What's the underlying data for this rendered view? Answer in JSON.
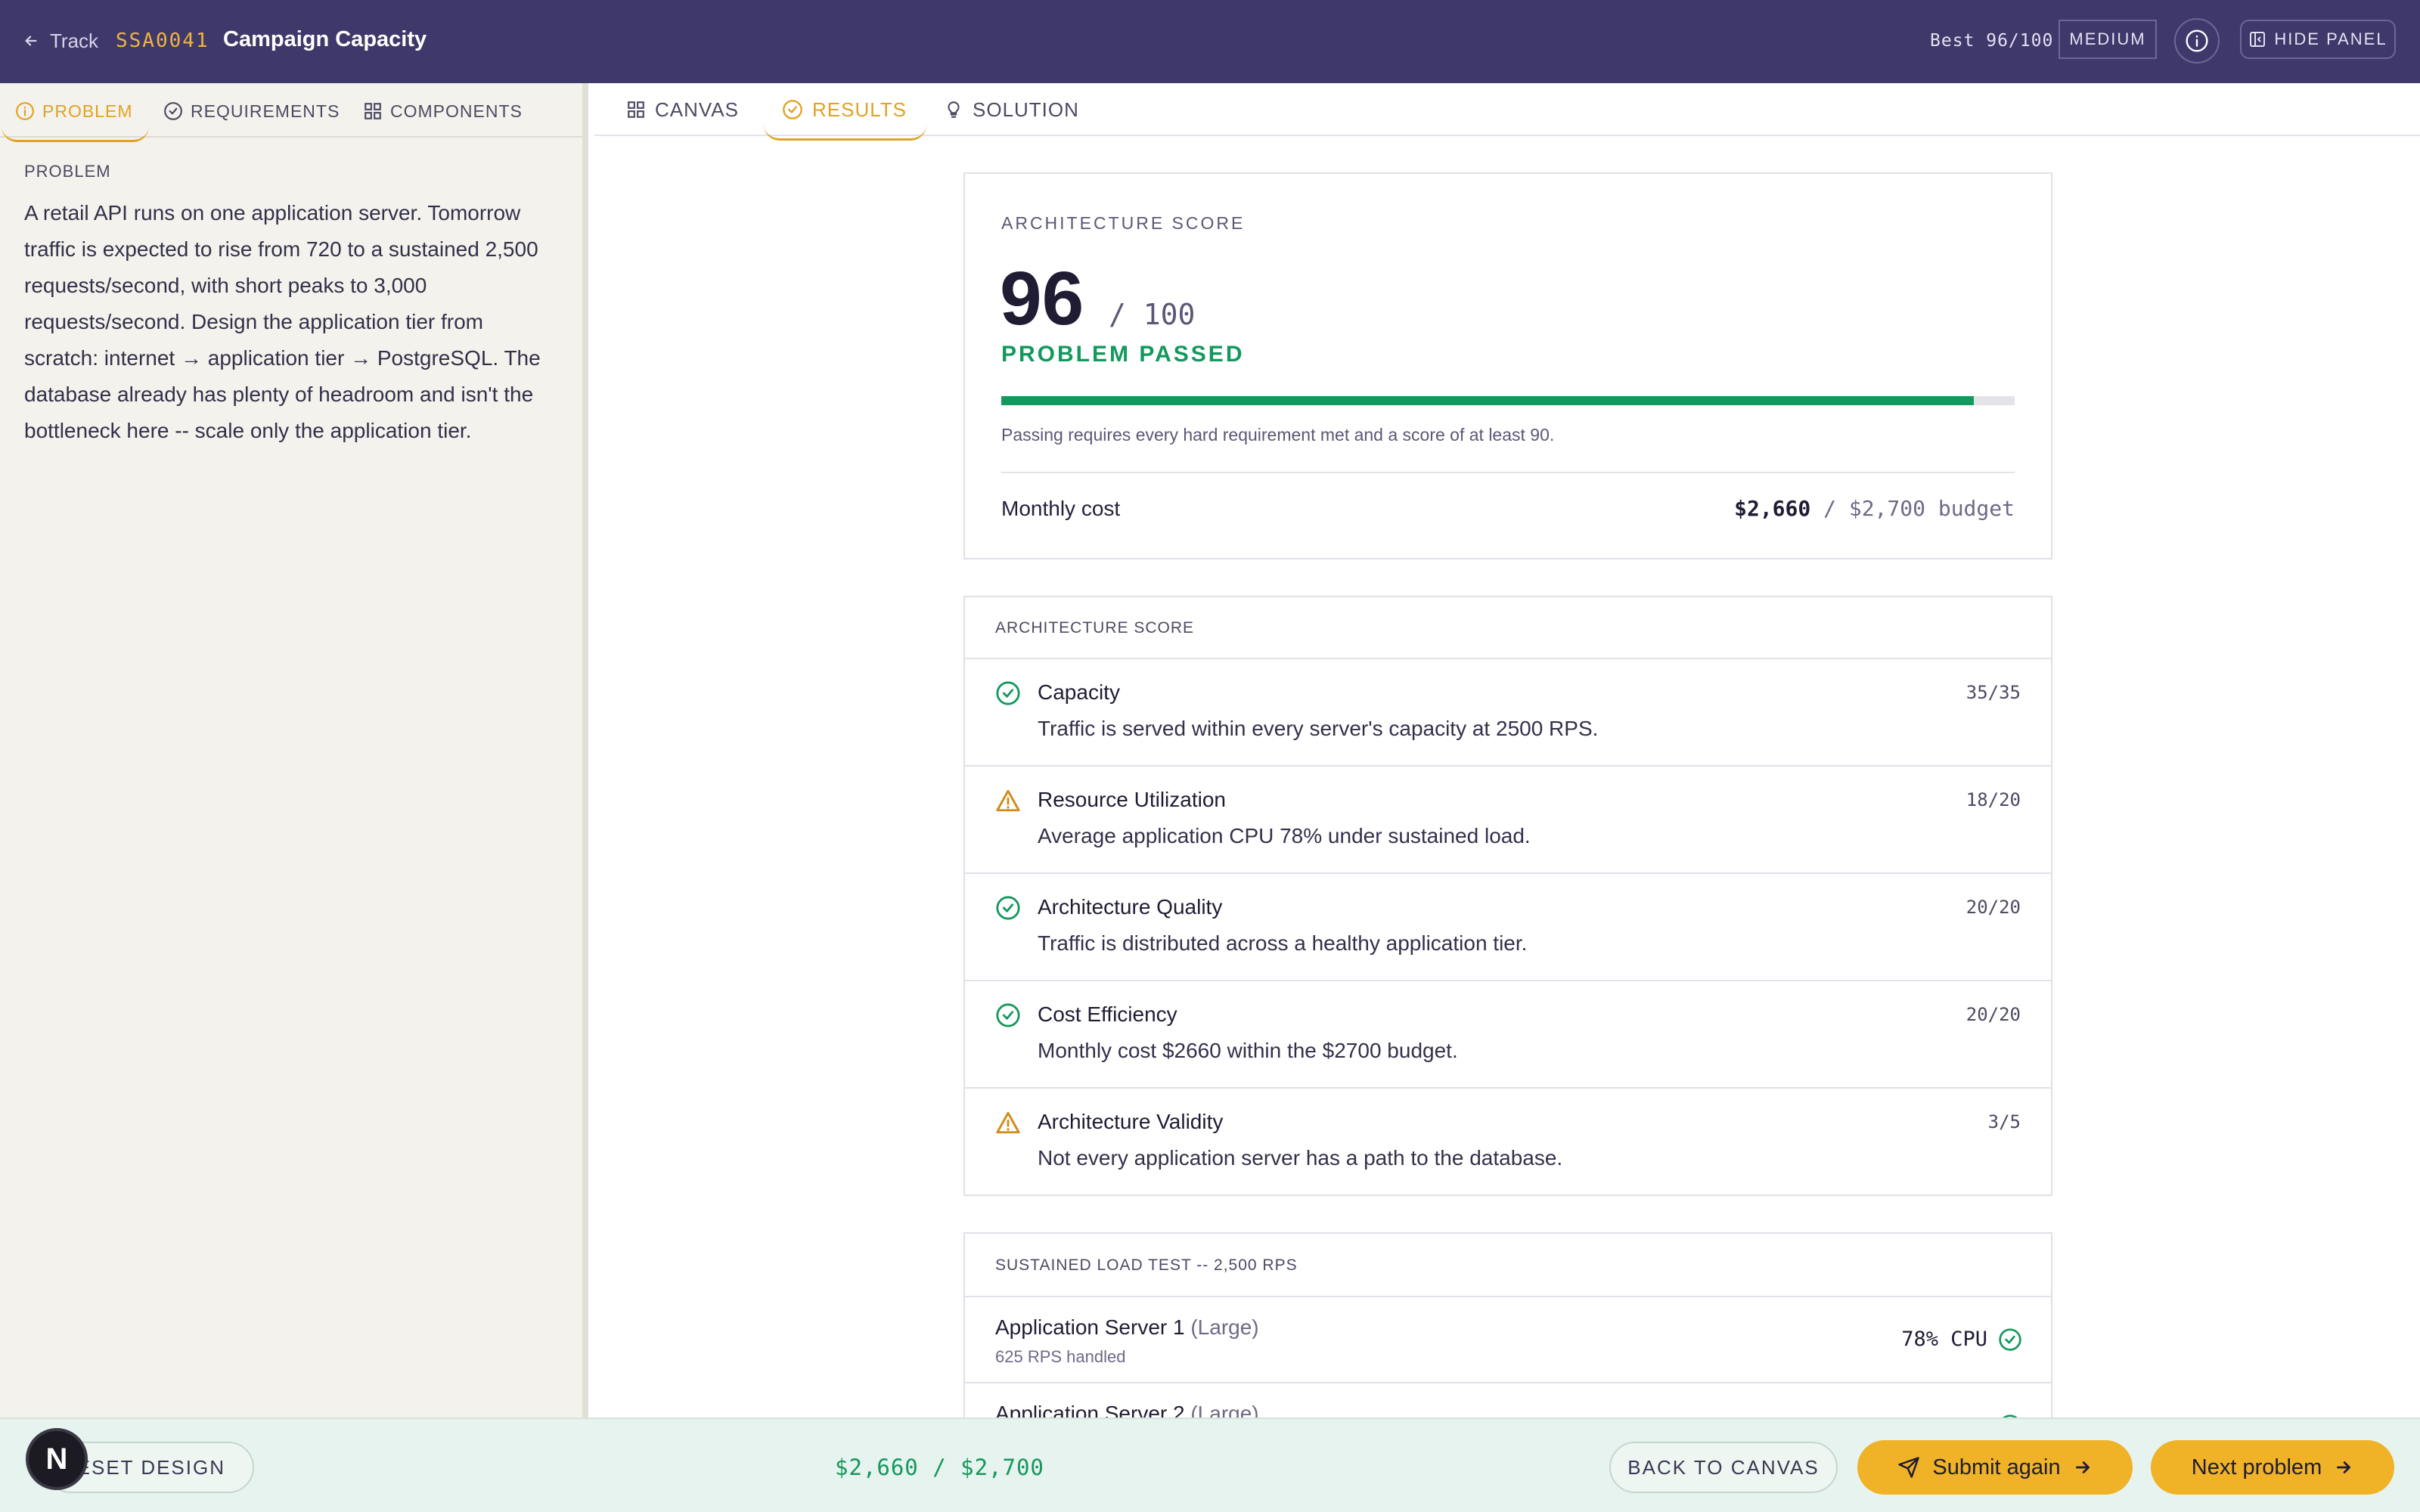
{
  "header": {
    "back_label": "Track",
    "problem_code": "SSA0041",
    "title": "Campaign Capacity",
    "best": "Best 96/100",
    "difficulty": "MEDIUM",
    "hide_panel_label": "HIDE PANEL"
  },
  "left_panel": {
    "tabs": [
      {
        "label": "PROBLEM",
        "icon": "info-icon",
        "active": true
      },
      {
        "label": "REQUIREMENTS",
        "icon": "check-circle-icon",
        "active": false
      },
      {
        "label": "COMPONENTS",
        "icon": "grid-icon",
        "active": false
      }
    ],
    "section_label": "PROBLEM",
    "problem_text": "A retail API runs on one application server. Tomorrow traffic is expected to rise from 720 to a sustained 2,500 requests/second, with short peaks to 3,000 requests/second. Design the application tier from scratch: internet → application tier → PostgreSQL. The database already has plenty of headroom and isn't the bottleneck here -- scale only the application tier."
  },
  "main_tabs": [
    {
      "label": "CANVAS",
      "icon": "grid-icon",
      "active": false
    },
    {
      "label": "RESULTS",
      "icon": "check-circle-icon",
      "active": true
    },
    {
      "label": "SOLUTION",
      "icon": "lightbulb-icon",
      "active": false
    }
  ],
  "score_card": {
    "label": "ARCHITECTURE SCORE",
    "score": "96",
    "max": "/ 100",
    "score_fraction": 0.96,
    "status": "PROBLEM PASSED",
    "note": "Passing requires every hard requirement met and a score of at least 90.",
    "cost_label": "Monthly cost",
    "cost_value": "$2,660",
    "cost_budget": "/ $2,700 budget"
  },
  "breakdown": {
    "header": "ARCHITECTURE SCORE",
    "items": [
      {
        "name": "Capacity",
        "desc": "Traffic is served within every server's capacity at 2500 RPS.",
        "score": "35/35",
        "status": "pass"
      },
      {
        "name": "Resource Utilization",
        "desc": "Average application CPU 78% under sustained load.",
        "score": "18/20",
        "status": "warn"
      },
      {
        "name": "Architecture Quality",
        "desc": "Traffic is distributed across a healthy application tier.",
        "score": "20/20",
        "status": "pass"
      },
      {
        "name": "Cost Efficiency",
        "desc": "Monthly cost $2660 within the $2700 budget.",
        "score": "20/20",
        "status": "pass"
      },
      {
        "name": "Architecture Validity",
        "desc": "Not every application server has a path to the database.",
        "score": "3/5",
        "status": "warn"
      }
    ]
  },
  "load_test": {
    "header": "SUSTAINED LOAD TEST -- 2,500 RPS",
    "servers": [
      {
        "name": "Application Server 1",
        "size": "(Large)",
        "handled": "625 RPS handled",
        "cpu": "78% CPU"
      },
      {
        "name": "Application Server 2",
        "size": "(Large)",
        "handled": "",
        "cpu": ""
      }
    ]
  },
  "footer": {
    "avatar_letter": "N",
    "reset_label": "RESET DESIGN",
    "cost": "$2,660 / $2,700",
    "back_label": "BACK TO CANVAS",
    "submit_label": "Submit again",
    "next_label": "Next problem"
  },
  "colors": {
    "header_bg": "#3f386b",
    "accent": "#f0b226",
    "pass": "#13985d",
    "warn": "#d18a17"
  }
}
